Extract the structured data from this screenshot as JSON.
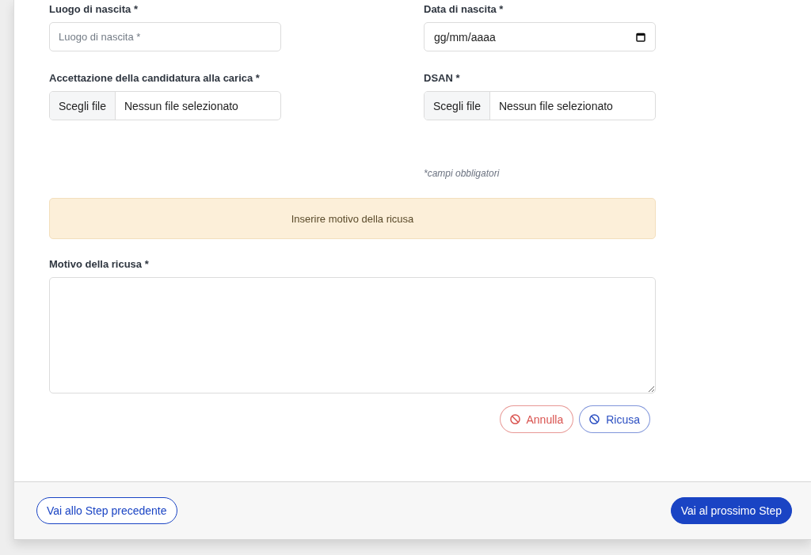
{
  "fields": [
    {
      "kind": "text",
      "label": "Luogo di nascita *",
      "placeholder": "Luogo di nascita *"
    },
    {
      "kind": "date",
      "label": "Data di nascita *",
      "placeholder": "gg/mm/aaaa"
    },
    {
      "kind": "file",
      "label": "Accettazione della candidatura alla carica *",
      "button": "Scegli file",
      "value": "Nessun file selezionato"
    },
    {
      "kind": "file",
      "label": "DSAN *",
      "button": "Scegli file",
      "value": "Nessun file selezionato"
    }
  ],
  "required_note": "*campi obbligatori",
  "alert": "Inserire motivo della ricusa",
  "reason": {
    "label": "Motivo della ricusa *"
  },
  "actions": [
    {
      "kind": "danger",
      "label": "Annulla"
    },
    {
      "kind": "primary",
      "label": "Ricusa"
    }
  ],
  "footer": [
    {
      "kind": "outline",
      "label": "Vai allo Step precedente"
    },
    {
      "kind": "solid",
      "label": "Vai al prossimo Step"
    }
  ]
}
